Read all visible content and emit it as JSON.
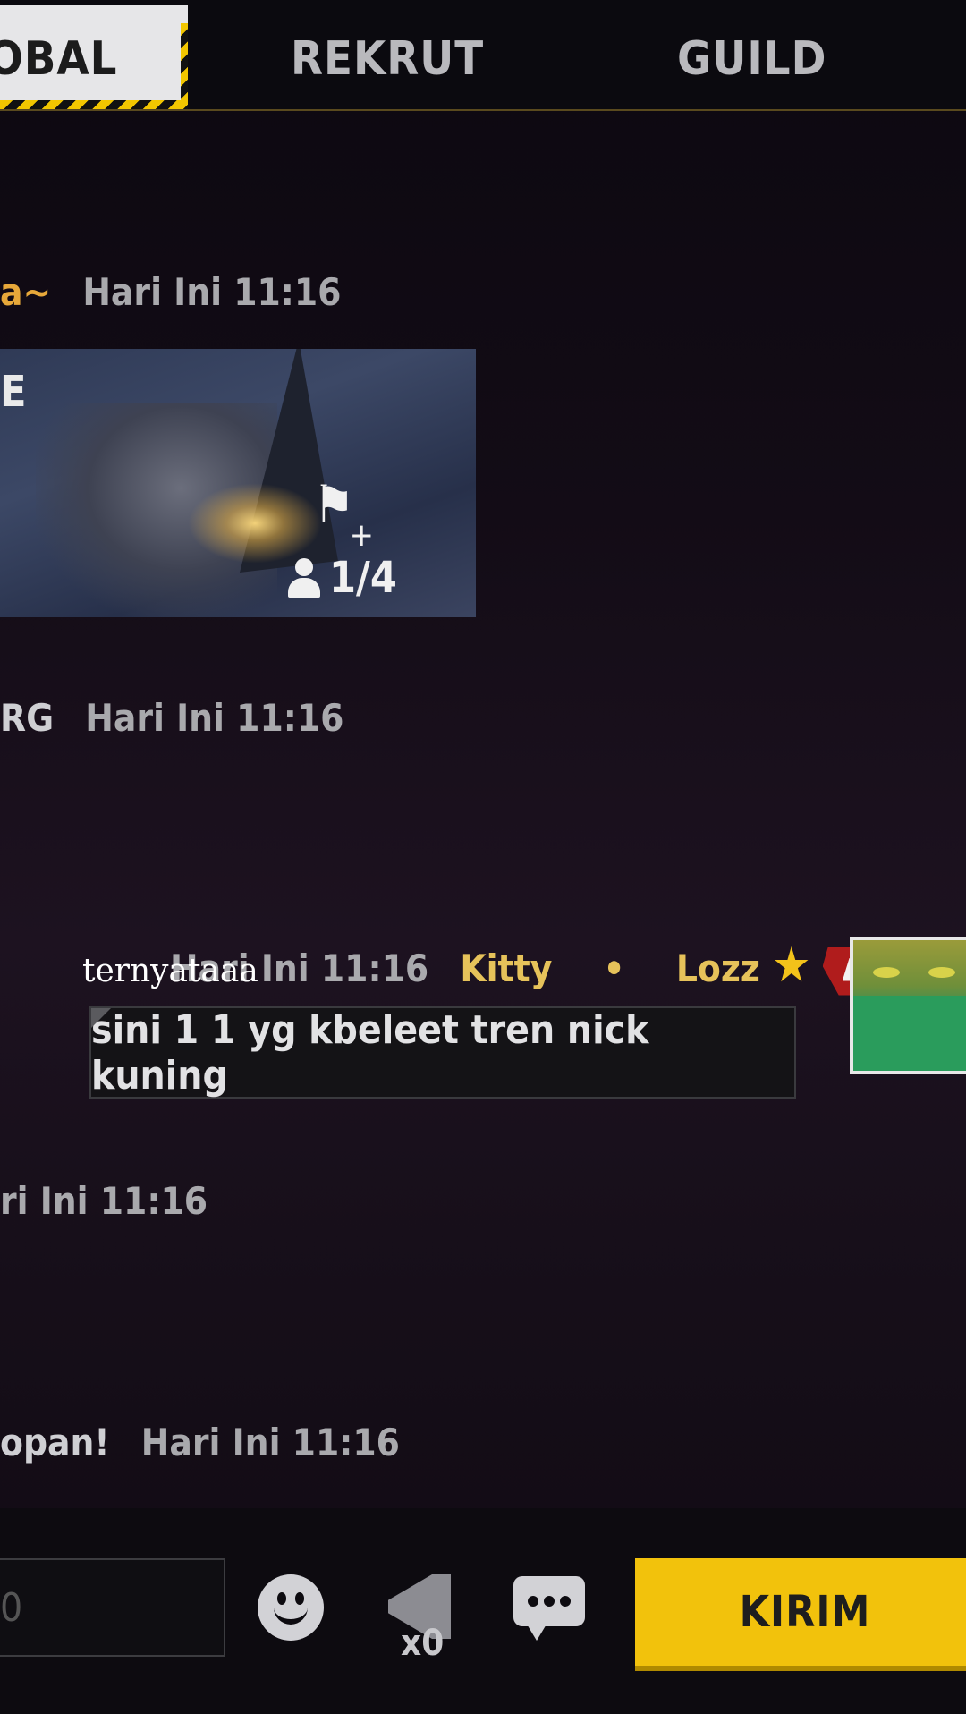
{
  "tabs": [
    {
      "label": "OBAL",
      "active": true
    },
    {
      "label": "REKRUT",
      "active": false
    },
    {
      "label": "GUILD",
      "active": false
    }
  ],
  "messages": [
    {
      "sender_fragment": "a~",
      "time": "Hari Ini 11:16"
    },
    {
      "card": {
        "title_fragment": "E",
        "slots": "1/4"
      }
    },
    {
      "sender_fragment": "RG",
      "time": "Hari Ini 11:16"
    },
    {
      "time": "Hari Ini 11:16",
      "sender_name": "Kitty",
      "separator": "•",
      "sender_tag": "Lozz",
      "text": "sini 1 1 yg kbeleet tren nick kuning"
    },
    {
      "time_fragment": "ri Ini 11:16"
    },
    {
      "sender_fragment": "opan!",
      "time": "Hari Ini 11:16"
    }
  ],
  "overlay_caption": "ternyataaa",
  "bottom_bar": {
    "input_fragment": "0",
    "broadcast_count": "x0",
    "send_label": "KIRIM"
  },
  "colors": {
    "accent": "#f2c20c",
    "sender_name": "#e6c25a",
    "sender_orange": "#e7a83a"
  }
}
